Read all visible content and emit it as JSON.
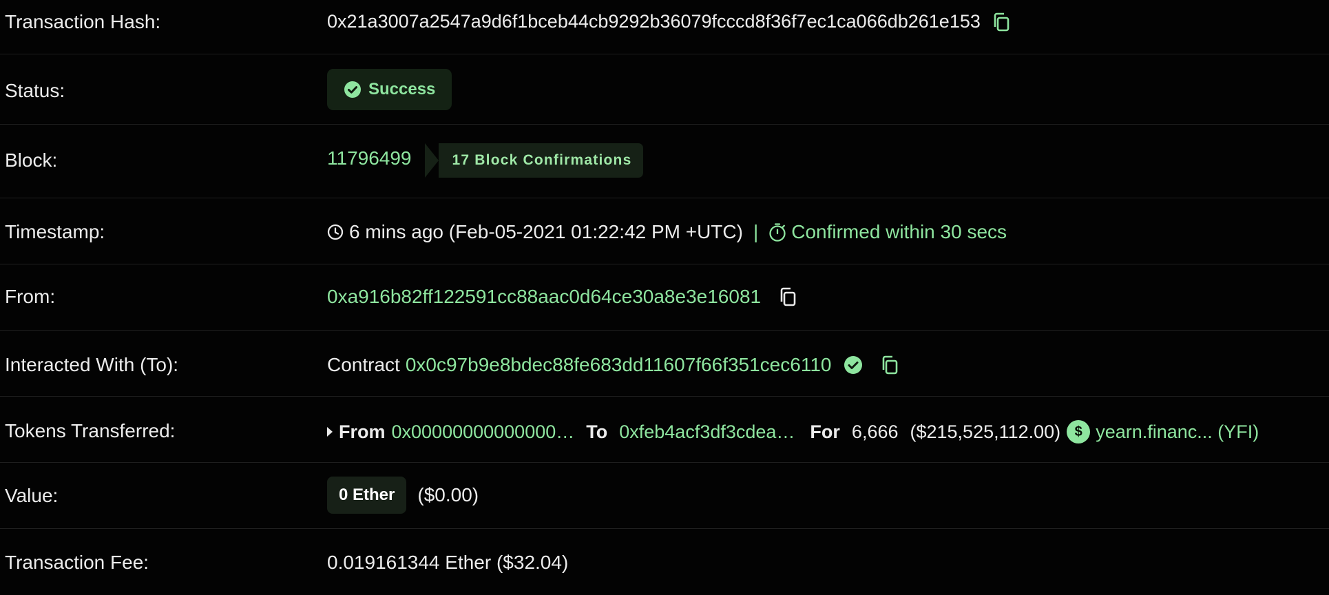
{
  "rows": {
    "hash": {
      "label": "Transaction Hash:",
      "value": "0x21a3007a2547a9d6f1bceb44cb9292b36079fcccd8f36f7ec1ca066db261e153"
    },
    "status": {
      "label": "Status:",
      "value": "Success"
    },
    "block": {
      "label": "Block:",
      "number": "11796499",
      "confirmations": "17 Block Confirmations"
    },
    "timestamp": {
      "label": "Timestamp:",
      "value": "6 mins ago (Feb-05-2021 01:22:42 PM +UTC)",
      "separator": "|",
      "confirmed": "Confirmed within 30 secs"
    },
    "from": {
      "label": "From:",
      "address": "0xa916b82ff122591cc88aac0d64ce30a8e3e16081"
    },
    "to": {
      "label": "Interacted With (To):",
      "prefix": "Contract",
      "address": "0x0c97b9e8bdec88fe683dd11607f66f351cec6110"
    },
    "tokens": {
      "label": "Tokens Transferred:",
      "from_label": "From",
      "from_address": "0x00000000000000…",
      "to_label": "To",
      "to_address": "0xfeb4acf3df3cdea…",
      "for_label": "For",
      "amount": "6,666",
      "usd": "($215,525,112.00)",
      "token_glyph": "$",
      "token_name": "yearn.financ... (YFI)"
    },
    "value": {
      "label": "Value:",
      "ether": "0 Ether",
      "usd": "($0.00)"
    },
    "fee": {
      "label": "Transaction Fee:",
      "value": "0.019161344 Ether ($32.04)"
    }
  },
  "colors": {
    "background": "#030303",
    "accent_green": "#8ee59f",
    "badge_bg": "#142214",
    "text": "#ececec",
    "divider": "#1f1f1f"
  },
  "icons": {
    "copy": "copy-icon",
    "success": "check-circle-icon",
    "clock": "clock-icon",
    "stopwatch": "stopwatch-icon",
    "verified": "verified-check-icon",
    "expand": "caret-right-icon",
    "token": "yfi-token-icon"
  }
}
